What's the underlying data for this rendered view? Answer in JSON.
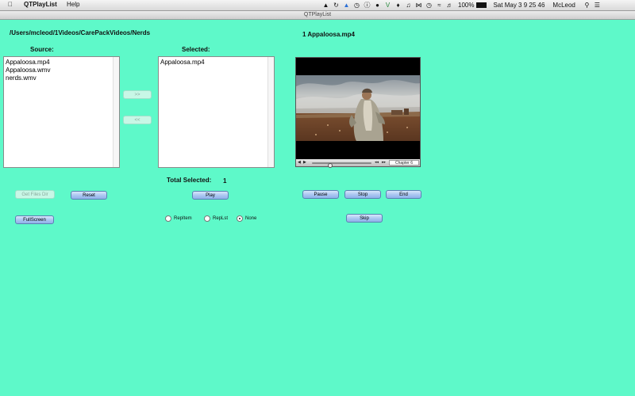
{
  "menubar": {
    "app_name": "QTPlayList",
    "help": "Help",
    "battery": "100%",
    "clock": "Sat May 3  9 25 46",
    "user": "McLeod"
  },
  "window": {
    "title": "QTPlayList"
  },
  "path": "/Users/mcleod/1Videos/CarePackVideos/Nerds",
  "now_playing": "1 Appaloosa.mp4",
  "source": {
    "label": "Source:",
    "items": [
      "Appaloosa.mp4",
      "Appaloosa.wmv",
      "nerds.wmv"
    ]
  },
  "selected": {
    "label": "Selected:",
    "items": [
      "Appaloosa.mp4"
    ]
  },
  "move_right_label": ">>",
  "move_left_label": "<<",
  "total_selected_label": "Total Selected:",
  "total_selected_value": "1",
  "buttons": {
    "get_files": "Get Files Dir",
    "reset": "Reset",
    "play": "Play",
    "pause": "Pause",
    "stop": "Stop",
    "end": "End",
    "fullscreen": "FullScreen",
    "skip": "Skip"
  },
  "radios": [
    {
      "label": "RepItem",
      "checked": false
    },
    {
      "label": "RepLst",
      "checked": false
    },
    {
      "label": "None",
      "checked": true
    }
  ],
  "player": {
    "chapter": "Chapter 6",
    "progress": 0.27
  }
}
